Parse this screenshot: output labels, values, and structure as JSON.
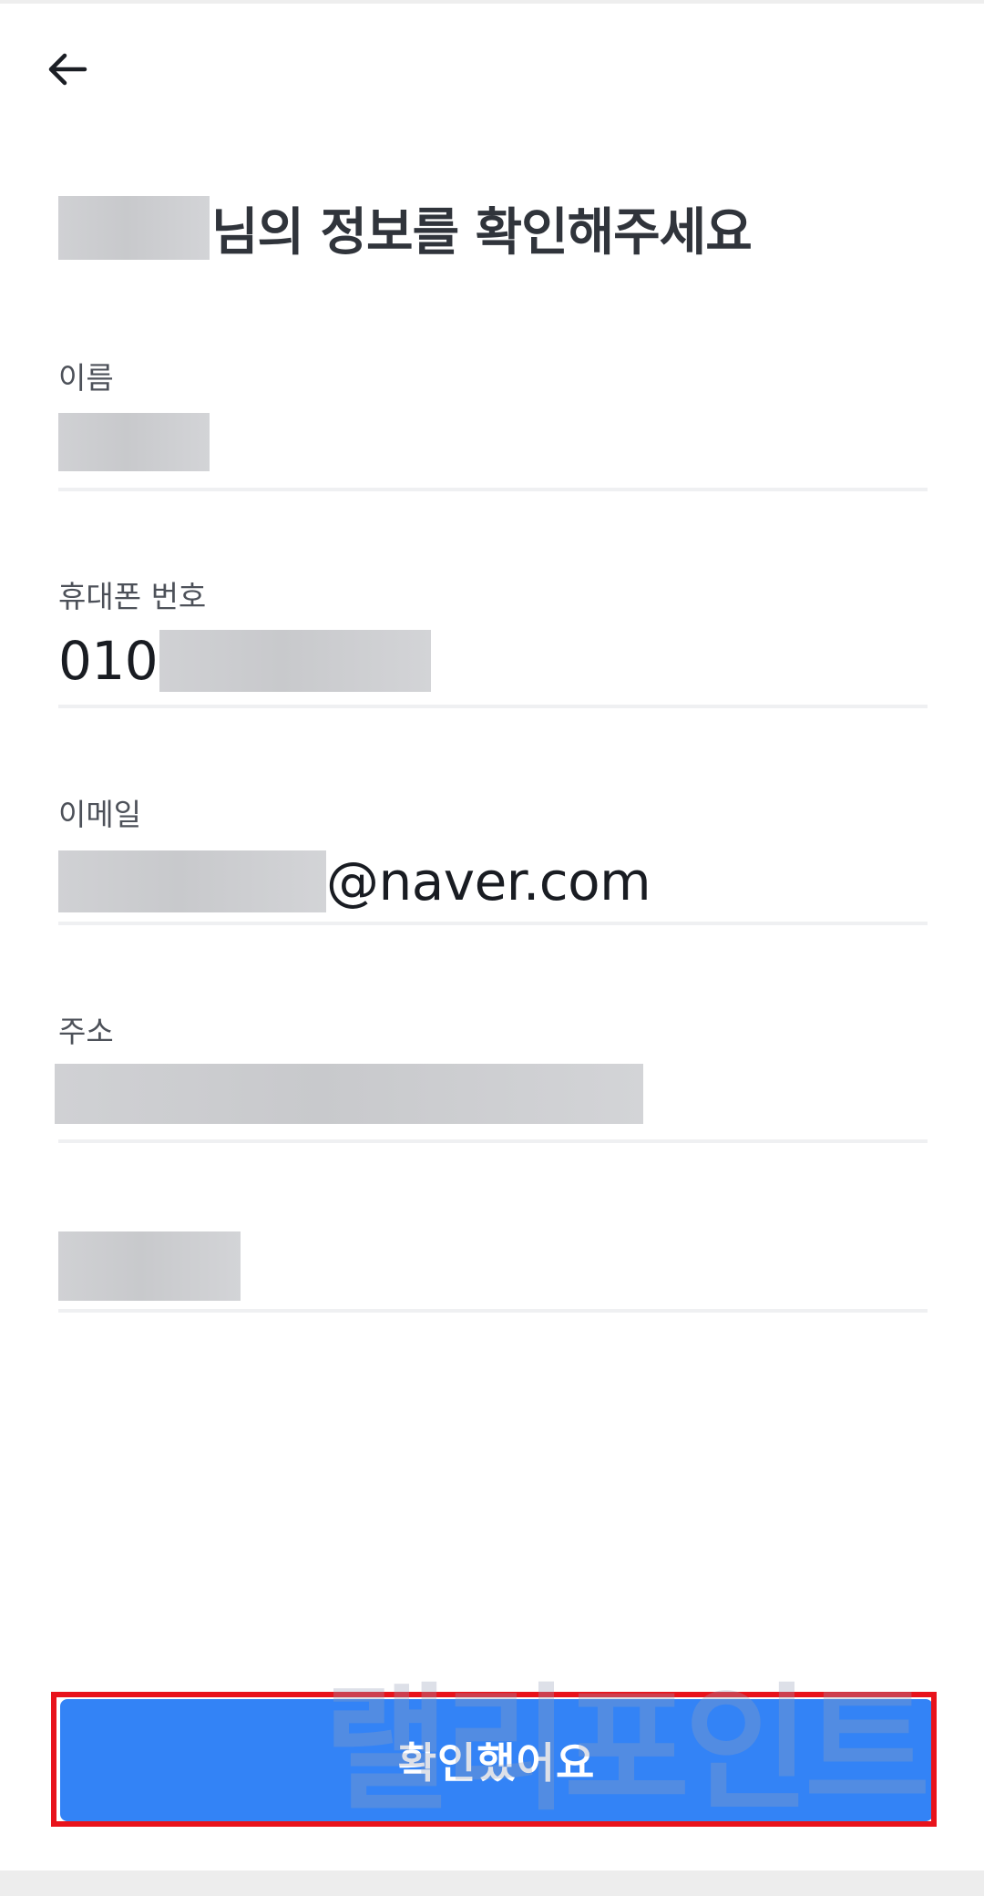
{
  "header": {
    "back_icon": "arrow-left-icon"
  },
  "title": {
    "suffix": "님의 정보를 확인해주세요"
  },
  "fields": {
    "name": {
      "label": "이름"
    },
    "phone": {
      "label": "휴대폰 번호",
      "prefix": "010"
    },
    "email": {
      "label": "이메일",
      "suffix": "@naver.com"
    },
    "address": {
      "label": "주소"
    }
  },
  "cta": {
    "label": "확인했어요"
  },
  "watermark": {
    "text": "랠리포인트"
  },
  "colors": {
    "accent": "#3383f6",
    "highlight": "#e8131c",
    "text": "#1b1e24"
  }
}
